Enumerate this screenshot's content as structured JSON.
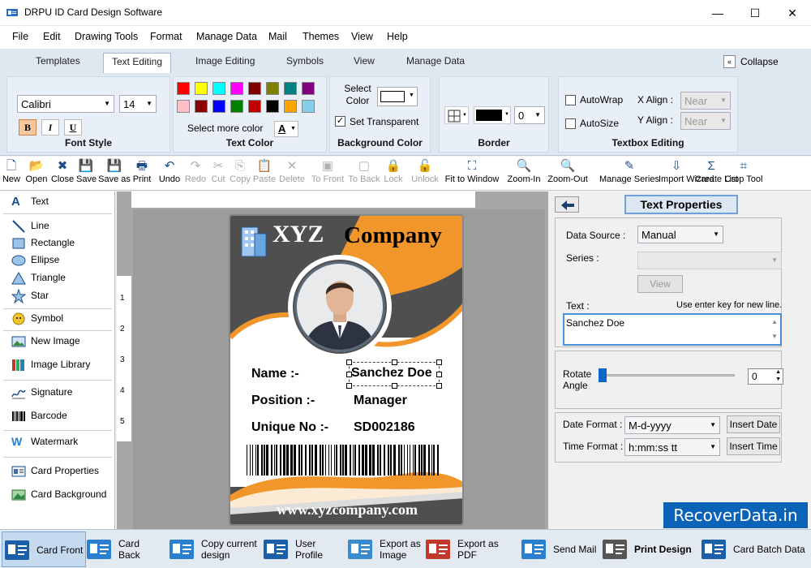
{
  "window": {
    "title": "DRPU ID Card Design Software",
    "minimize": "—",
    "maximize": "☐",
    "close": "✕"
  },
  "menu": [
    "File",
    "Edit",
    "Drawing Tools",
    "Format",
    "Manage Data",
    "Mail",
    "Themes",
    "View",
    "Help"
  ],
  "tabs": [
    "Templates",
    "Text Editing",
    "Image Editing",
    "Symbols",
    "View",
    "Manage Data"
  ],
  "collapse_label": "Collapse",
  "ribbon": {
    "font_style": {
      "label": "Font Style",
      "font": "Calibri",
      "size": "14",
      "bold": "B",
      "italic": "I",
      "underline": "U"
    },
    "text_color": {
      "label": "Text Color",
      "more": "Select more color",
      "a_glyph": "A",
      "colors_row1": [
        "#ff0000",
        "#ffff00",
        "#00ffff",
        "#ff00ff",
        "#800000",
        "#808000",
        "#008080",
        "#800080"
      ],
      "colors_row2": [
        "#ffc0cb",
        "#8b0000",
        "#0000ff",
        "#008000",
        "#c00000",
        "#000000",
        "#ffa500",
        "#87ceeb"
      ]
    },
    "background_color": {
      "label": "Background Color",
      "select_color": "Select\nColor",
      "set_transparent": "Set Transparent"
    },
    "border": {
      "label": "Border",
      "width": "0"
    },
    "textbox_editing": {
      "label": "Textbox Editing",
      "autowrap": "AutoWrap",
      "autosize": "AutoSize",
      "x_align": "X Align :",
      "y_align": "Y Align :",
      "x_value": "Near",
      "y_value": "Near"
    }
  },
  "toolbar": [
    {
      "label": "New",
      "icon": "new-file-icon",
      "enabled": true
    },
    {
      "label": "Open",
      "icon": "folder-open-icon",
      "enabled": true
    },
    {
      "label": "Close",
      "icon": "close-file-icon",
      "enabled": true
    },
    {
      "label": "Save",
      "icon": "save-icon",
      "enabled": true
    },
    {
      "label": "Save as",
      "icon": "save-as-icon",
      "enabled": true
    },
    {
      "label": "Print",
      "icon": "print-icon",
      "enabled": true
    },
    {
      "label": "Undo",
      "icon": "undo-icon",
      "enabled": true
    },
    {
      "label": "Redo",
      "icon": "redo-icon",
      "enabled": false
    },
    {
      "label": "Cut",
      "icon": "cut-icon",
      "enabled": false
    },
    {
      "label": "Copy",
      "icon": "copy-icon",
      "enabled": false
    },
    {
      "label": "Paste",
      "icon": "paste-icon",
      "enabled": false
    },
    {
      "label": "Delete",
      "icon": "delete-icon",
      "enabled": false
    },
    {
      "label": "To Front",
      "icon": "to-front-icon",
      "enabled": false
    },
    {
      "label": "To Back",
      "icon": "to-back-icon",
      "enabled": false
    },
    {
      "label": "Lock",
      "icon": "lock-icon",
      "enabled": false
    },
    {
      "label": "Unlock",
      "icon": "unlock-icon",
      "enabled": false
    },
    {
      "label": "Fit to Window",
      "icon": "fit-window-icon",
      "enabled": true
    },
    {
      "label": "Zoom-In",
      "icon": "zoom-in-icon",
      "enabled": true
    },
    {
      "label": "Zoom-Out",
      "icon": "zoom-out-icon",
      "enabled": true
    },
    {
      "label": "Manage Series",
      "icon": "manage-series-icon",
      "enabled": true
    },
    {
      "label": "Import Wizard",
      "icon": "import-wizard-icon",
      "enabled": true
    },
    {
      "label": "Create List",
      "icon": "create-list-icon",
      "enabled": true
    },
    {
      "label": "Crop Tool",
      "icon": "crop-icon",
      "enabled": true
    }
  ],
  "left_panel": [
    "Text",
    "Line",
    "Rectangle",
    "Ellipse",
    "Triangle",
    "Star",
    "Symbol",
    "New Image",
    "Image Library",
    "Signature",
    "Barcode",
    "Watermark",
    "Card Properties",
    "Card Background"
  ],
  "ruler_numbers": [
    "1",
    "2",
    "3",
    "4",
    "5"
  ],
  "card": {
    "company_left": "XYZ",
    "company_right": "Company",
    "name_label": "Name :-",
    "name_value": "Sanchez Doe",
    "position_label": "Position :-",
    "position_value": "Manager",
    "unique_label": "Unique No :-",
    "unique_value": "SD002186",
    "website": "www.xyzcompany.com",
    "accent": "#f0962a",
    "dark": "#555555"
  },
  "properties": {
    "title": "Text Properties",
    "data_source_label": "Data Source :",
    "data_source_value": "Manual",
    "series_label": "Series :",
    "view_button": "View",
    "text_label": "Text :",
    "text_hint": "Use enter key for new line.",
    "text_value": "Sanchez Doe",
    "rotate_label": "Rotate\nAngle",
    "rotate_value": "0",
    "date_format_label": "Date Format :",
    "date_format_value": "M-d-yyyy",
    "insert_date": "Insert Date",
    "time_format_label": "Time Format :",
    "time_format_value": "h:mm:ss tt",
    "insert_time": "Insert Time"
  },
  "bottom_bar": [
    {
      "label": "Card Front",
      "icon": "card-front-icon"
    },
    {
      "label": "Card Back",
      "icon": "card-back-icon"
    },
    {
      "label": "Copy current design",
      "icon": "copy-design-icon"
    },
    {
      "label": "User Profile",
      "icon": "user-profile-icon"
    },
    {
      "label": "Export as Image",
      "icon": "export-image-icon"
    },
    {
      "label": "Export as PDF",
      "icon": "export-pdf-icon"
    },
    {
      "label": "Send Mail",
      "icon": "send-mail-icon"
    },
    {
      "label": "Print Design",
      "icon": "print-design-icon"
    },
    {
      "label": "Card Batch Data",
      "icon": "card-batch-icon"
    }
  ],
  "watermark": "RecoverData.in"
}
